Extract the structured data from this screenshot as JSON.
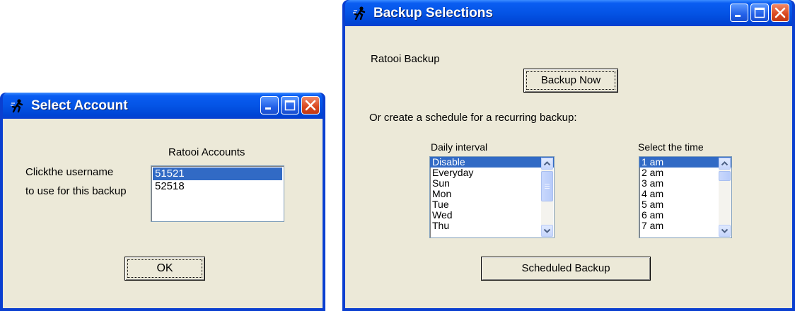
{
  "select_account": {
    "title": "Select Account",
    "accounts_label": "Ratooi Accounts",
    "instruction_line1": "Clickthe username",
    "instruction_line2": "to use for this backup",
    "accounts": [
      "51521",
      "52518"
    ],
    "selected_account": "51521",
    "ok_label": "OK"
  },
  "backup_selections": {
    "title": "Backup Selections",
    "app_label": "Ratooi Backup",
    "backup_now_label": "Backup Now",
    "schedule_prompt": "Or create a schedule for a recurring backup:",
    "daily_interval_label": "Daily interval",
    "daily_interval_items": [
      "Disable",
      "Everyday",
      "Sun",
      "Mon",
      "Tue",
      "Wed",
      "Thu"
    ],
    "daily_interval_selected": "Disable",
    "time_label": "Select the time",
    "time_items": [
      "1 am",
      "2 am",
      "3 am",
      "4 am",
      "5 am",
      "6 am",
      "7 am"
    ],
    "time_selected": "1 am",
    "scheduled_backup_label": "Scheduled Backup"
  },
  "icons": {
    "app": "runner-icon",
    "minimize": "minimize-icon",
    "maximize": "maximize-icon",
    "close": "close-icon",
    "scroll_up": "chevron-up-icon",
    "scroll_down": "chevron-down-icon"
  },
  "colors": {
    "titlebar": "#0454e5",
    "window_border": "#0a3fd0",
    "dialog_bg": "#ece9d8",
    "selection": "#316ac5",
    "close_button": "#d9471e"
  }
}
